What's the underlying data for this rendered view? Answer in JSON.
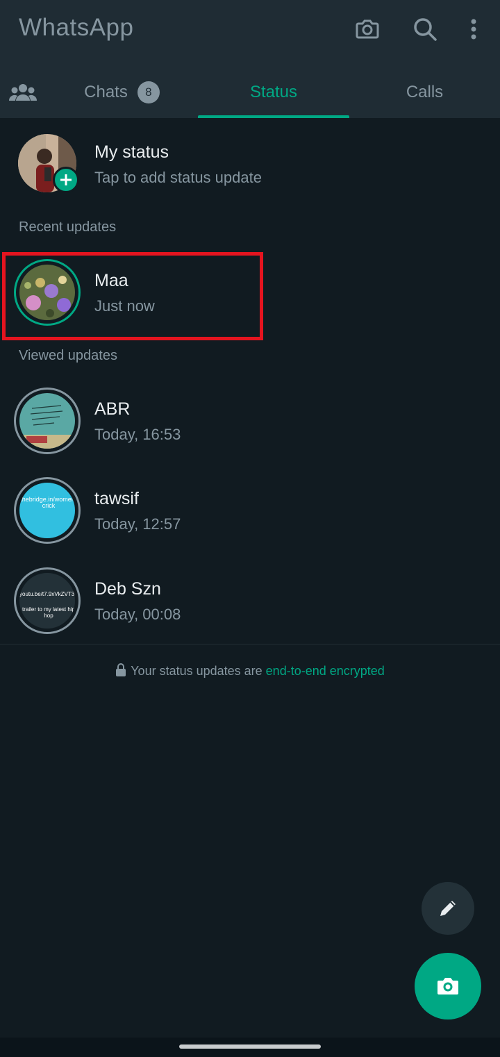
{
  "header": {
    "title": "WhatsApp",
    "icons": [
      "camera-icon",
      "search-icon",
      "more-vert-icon"
    ]
  },
  "tabs": {
    "community_icon": "community-icon",
    "chats_label": "Chats",
    "chats_badge": "8",
    "status_label": "Status",
    "calls_label": "Calls",
    "active": "Status"
  },
  "my_status": {
    "name": "My status",
    "subtitle": "Tap to add status update"
  },
  "recent": {
    "label": "Recent updates",
    "items": [
      {
        "name": "Maa",
        "time": "Just now"
      }
    ]
  },
  "viewed": {
    "label": "Viewed updates",
    "items": [
      {
        "name": "ABR",
        "time": "Today, 16:53"
      },
      {
        "name": "tawsif",
        "time": "Today, 12:57",
        "thumb_text": "thebridge.in/women-crick"
      },
      {
        "name": "Deb Szn",
        "time": "Today, 00:08",
        "thumb_text_1": "youtu.be/t7.9xVkZVT3Q",
        "thumb_text_2": "trailer to my latest hip hop"
      }
    ]
  },
  "footer": {
    "encryption_prefix": "Your status updates are ",
    "encryption_link": "end-to-end encrypted"
  },
  "colors": {
    "accent": "#00a884",
    "background": "#111b21",
    "header": "#1f2c34",
    "highlight": "#e5141f"
  }
}
